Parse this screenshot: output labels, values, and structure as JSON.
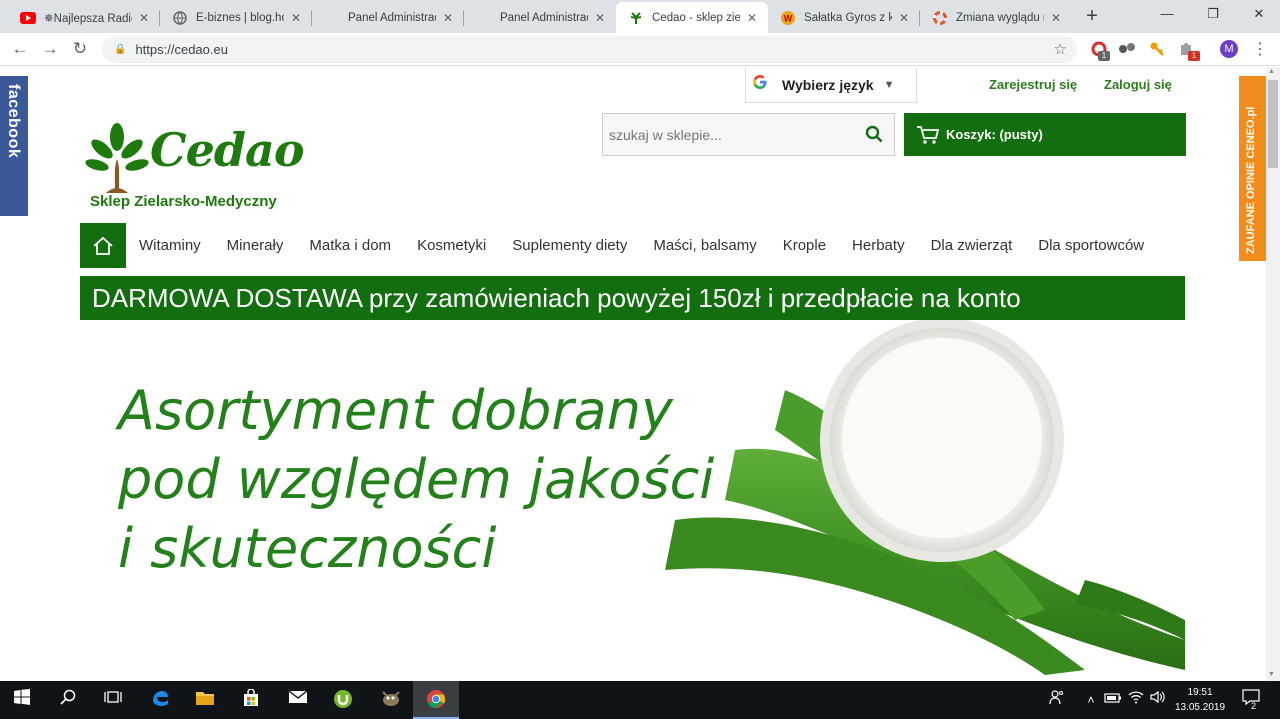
{
  "browser": {
    "tabs": [
      {
        "title": "✵Najlepsza Radio",
        "icon": "youtube-icon"
      },
      {
        "title": "E-biznes | blog.hor",
        "icon": "globe-icon"
      },
      {
        "title": "Panel Administracy",
        "icon": "blank-icon"
      },
      {
        "title": "Panel Administracy",
        "icon": "blank-icon"
      },
      {
        "title": "Cedao - sklep ziela",
        "icon": "cedao-icon"
      },
      {
        "title": "Sałatka Gyros z ku",
        "icon": "wp-icon"
      },
      {
        "title": "Zmiana wyglądu m",
        "icon": "lifebuoy-icon"
      }
    ],
    "active_tab": 4,
    "url": "https://cedao.eu",
    "ext_badges": [
      "1",
      "1"
    ],
    "profile_initial": "M"
  },
  "page": {
    "facebook_label": "facebook",
    "ceneo_label": "ZAUFANE OPINIE CENEO.pl",
    "language_label": "Wybierz język",
    "register_label": "Zarejestruj się",
    "login_label": "Zaloguj się",
    "logo_brand": "Cedao",
    "logo_sub": "Sklep Zielarsko-Medyczny",
    "search_placeholder": "szukaj w sklepie...",
    "cart_label": "Koszyk: (pusty)",
    "menu": [
      "Witaminy",
      "Minerały",
      "Matka i dom",
      "Kosmetyki",
      "Suplementy diety",
      "Maści, balsamy",
      "Krople",
      "Herbaty",
      "Dla zwierząt",
      "Dla sportowców"
    ],
    "banner": "DARMOWA DOSTAWA przy zamówieniach powyżej 150zł i przedpłacie na konto",
    "hero_lines": [
      "Asortyment dobrany",
      "pod względem jakości",
      "i skuteczności"
    ]
  },
  "taskbar": {
    "time": "19:51",
    "date": "13.05.2019",
    "notifications": "2"
  },
  "colors": {
    "brand_green": "#126e0e",
    "text_green": "#23801a",
    "facebook_blue": "#3b5998",
    "ceneo_orange": "#f28c1c"
  }
}
